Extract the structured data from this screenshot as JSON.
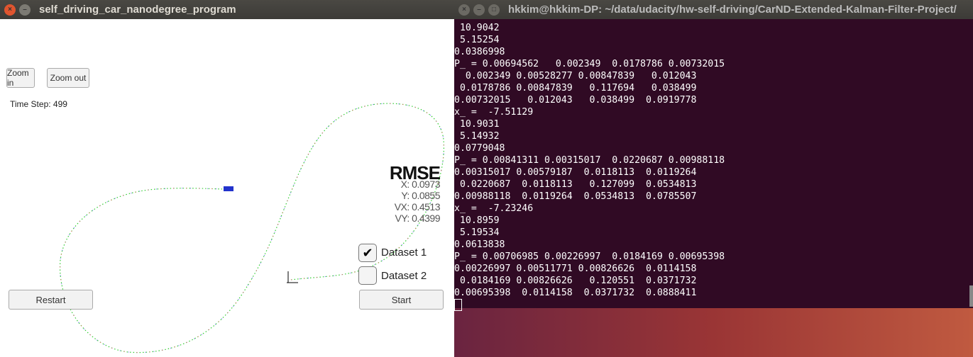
{
  "simulator": {
    "title": "self_driving_car_nanodegree_program",
    "zoom_in": "Zoom in",
    "zoom_out": "Zoom out",
    "time_step": "Time Step: 499",
    "rmse": {
      "title": "RMSE",
      "x": "X: 0.0973",
      "y": "Y: 0.0855",
      "vx": "VX: 0.4513",
      "vy": "VY: 0.4399"
    },
    "dataset1": {
      "label": "Dataset 1",
      "checked": true
    },
    "dataset2": {
      "label": "Dataset 2",
      "checked": false
    },
    "restart": "Restart",
    "start": "Start"
  },
  "terminal": {
    "title": "hkkim@hkkim-DP: ~/data/udacity/hw-self-driving/CarND-Extended-Kalman-Filter-Project/",
    "lines": [
      " 10.9042",
      " 5.15254",
      "0.0386998",
      "P_ = 0.00694562   0.002349  0.0178786 0.00732015",
      "  0.002349 0.00528277 0.00847839   0.012043",
      " 0.0178786 0.00847839   0.117694   0.038499",
      "0.00732015   0.012043   0.038499  0.0919778",
      "x_ =  -7.51129",
      " 10.9031",
      " 5.14932",
      "0.0779048",
      "P_ = 0.00841311 0.00315017  0.0220687 0.00988118",
      "0.00315017 0.00579187  0.0118113  0.0119264",
      " 0.0220687  0.0118113   0.127099  0.0534813",
      "0.00988118  0.0119264  0.0534813  0.0785507",
      "x_ =  -7.23246",
      " 10.8959",
      " 5.19534",
      "0.0613838",
      "P_ = 0.00706985 0.00226997  0.0184169 0.00695398",
      "0.00226997 0.00511771 0.00826626  0.0114158",
      " 0.0184169 0.00826626   0.120551  0.0371732",
      "0.00695398  0.0114158  0.0371732  0.0888411"
    ]
  }
}
